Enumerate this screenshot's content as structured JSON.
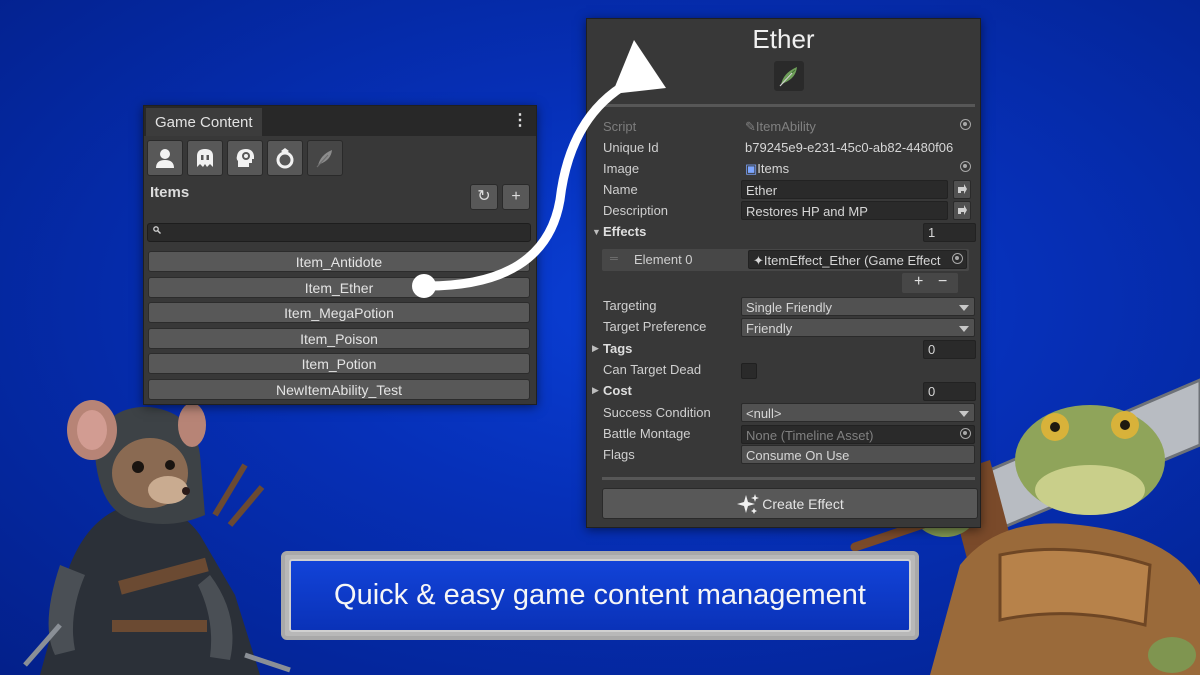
{
  "left_panel": {
    "tab_title": "Game Content",
    "menu_glyph": "⋮",
    "category_icons": [
      "person-icon",
      "ghost-icon",
      "head-gear-icon",
      "ring-icon",
      "feather-icon"
    ],
    "section_title": "Items",
    "refresh_glyph": "↻",
    "add_glyph": "+",
    "search_glyph": "🔍",
    "items": [
      "Item_Antidote",
      "Item_Ether",
      "Item_MegaPotion",
      "Item_Poison",
      "Item_Potion",
      "NewItemAbility_Test"
    ],
    "selected_item": "Item_Ether"
  },
  "inspector": {
    "title": "Ether",
    "script_label": "Script",
    "script_value": "ItemAbility",
    "unique_id_label": "Unique Id",
    "unique_id_value": "b79245e9-e231-45c0-ab82-4480f06",
    "image_label": "Image",
    "image_value": "Items",
    "name_label": "Name",
    "name_value": "Ether",
    "description_label": "Description",
    "description_value": "Restores HP and MP",
    "effects_label": "Effects",
    "effects_count": "1",
    "element_label": "Element 0",
    "element_value": "ItemEffect_Ether (Game Effect",
    "list_add": "+",
    "list_remove": "−",
    "targeting_label": "Targeting",
    "targeting_value": "Single Friendly",
    "target_pref_label": "Target Preference",
    "target_pref_value": "Friendly",
    "tags_label": "Tags",
    "tags_count": "0",
    "can_target_dead_label": "Can Target Dead",
    "cost_label": "Cost",
    "cost_count": "0",
    "success_label": "Success Condition",
    "success_value": "<null>",
    "montage_label": "Battle Montage",
    "montage_value": "None (Timeline Asset)",
    "flags_label": "Flags",
    "flags_value": "Consume On Use",
    "create_effect_label": "Create Effect"
  },
  "banner": {
    "text": "Quick & easy game content management"
  },
  "colors": {
    "background": "#0630b8",
    "panel": "#383838",
    "field": "#2a2a2a",
    "button": "#585858",
    "arrow": "#ffffff"
  }
}
